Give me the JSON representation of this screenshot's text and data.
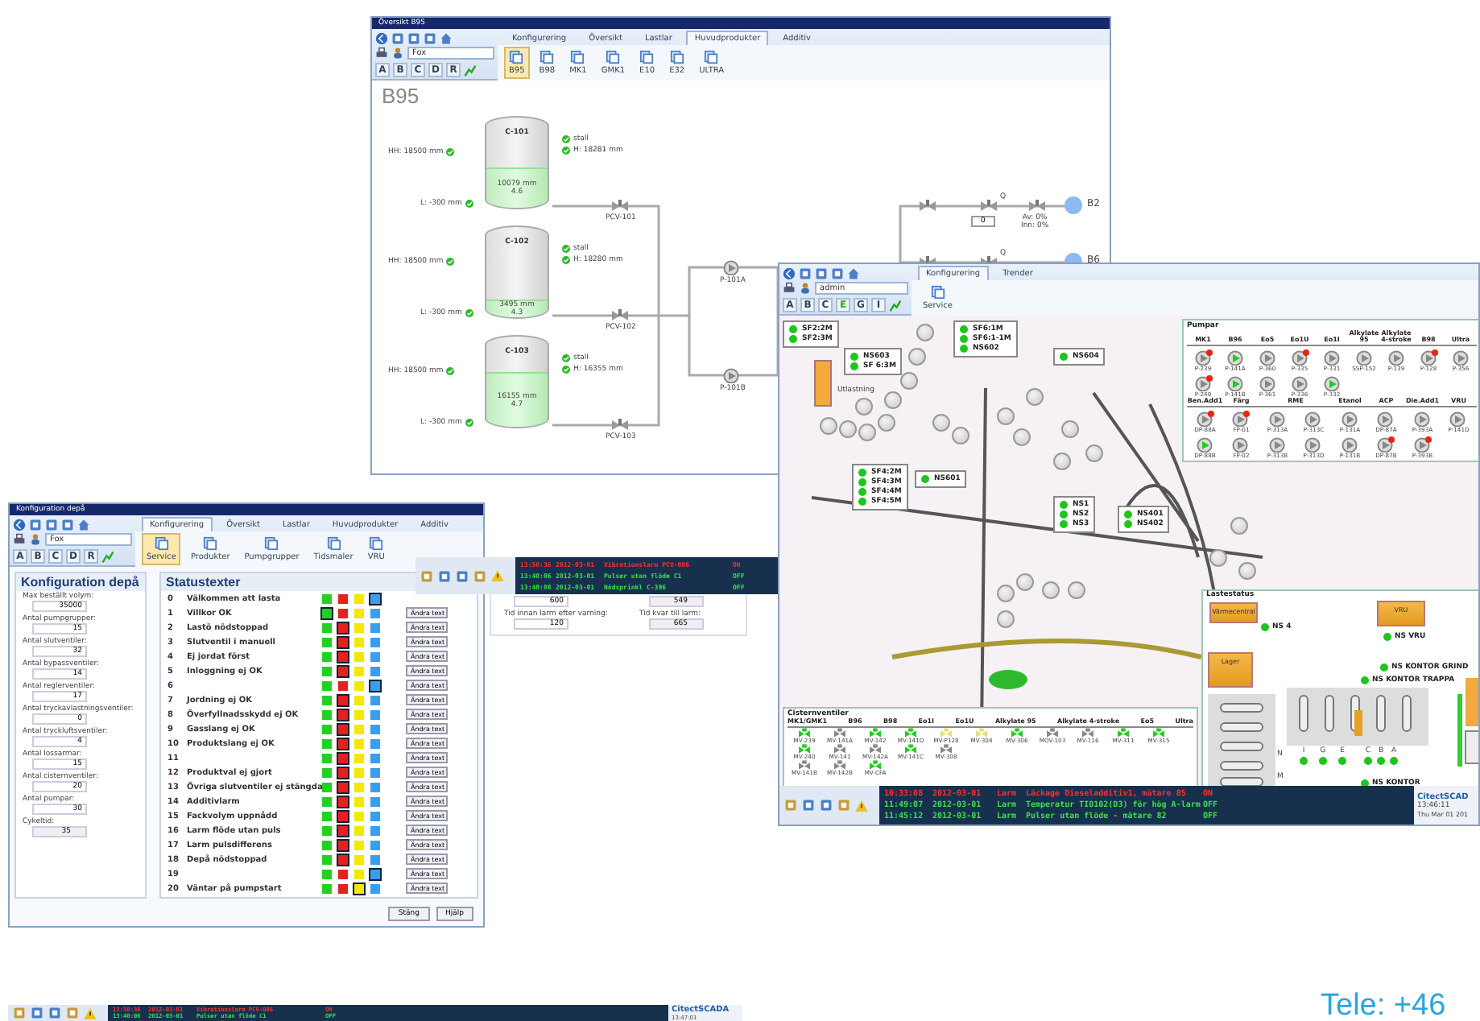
{
  "tank_window": {
    "title": "Översikt B95",
    "tabs": [
      {
        "label": "Konfigurering",
        "selected": false
      },
      {
        "label": "Översikt",
        "selected": false
      },
      {
        "label": "Lastlar",
        "selected": false
      },
      {
        "label": "Huvudprodukter",
        "selected": true
      },
      {
        "label": "Additiv",
        "selected": false
      }
    ],
    "field": "Fox",
    "letters": [
      {
        "label": "A",
        "selected": false
      },
      {
        "label": "B",
        "selected": false
      },
      {
        "label": "C",
        "selected": false
      },
      {
        "label": "D",
        "selected": false
      },
      {
        "label": "R",
        "selected": false
      }
    ],
    "buttons": [
      {
        "label": "B95",
        "selected": true
      },
      {
        "label": "B98",
        "selected": false
      },
      {
        "label": "MK1",
        "selected": false
      },
      {
        "label": "GMK1",
        "selected": false
      },
      {
        "label": "E10",
        "selected": false
      },
      {
        "label": "E32",
        "selected": false
      },
      {
        "label": "ULTRA",
        "selected": false
      }
    ],
    "heading": "B95",
    "tanks": [
      {
        "name": "C-101",
        "high_limit": "HH: 18500 mm",
        "low_limit": "L: -300 mm",
        "level": 0.45,
        "reading": "10079 mm",
        "temperature": "4.6",
        "status": "stall",
        "height": "H: 18281 mm",
        "valve": "PCV-101"
      },
      {
        "name": "C-102",
        "high_limit": "HH: 18500 mm",
        "low_limit": "L: -300 mm",
        "level": 0.2,
        "reading": "3495 mm",
        "temperature": "4.3",
        "status": "stall",
        "height": "H: 18280 mm",
        "valve": "PCV-102"
      },
      {
        "name": "C-103",
        "high_limit": "HH: 18500 mm",
        "low_limit": "L: -300 mm",
        "level": 0.6,
        "reading": "16155 mm",
        "temperature": "4.7",
        "status": "stall",
        "height": "H: 16355 mm",
        "valve": "PCV-103"
      }
    ],
    "pumps": [
      {
        "name": "P-101A"
      },
      {
        "name": "P-101B"
      }
    ],
    "outlets": [
      {
        "name": "B2",
        "meter": "Q",
        "flow": "0",
        "shares": [
          "Av: 0%",
          "Inn: 0%"
        ]
      },
      {
        "name": "B6",
        "meter": "Q"
      }
    ]
  },
  "config_window": {
    "title": "Konfiguration depå",
    "tabs": [
      {
        "label": "Konfigurering",
        "selected": true
      },
      {
        "label": "Översikt",
        "selected": false
      },
      {
        "label": "Lastlar",
        "selected": false
      },
      {
        "label": "Huvudprodukter",
        "selected": false
      },
      {
        "label": "Additiv",
        "selected": false
      }
    ],
    "field": "Fox",
    "letters": [
      {
        "label": "A",
        "selected": false
      },
      {
        "label": "B",
        "selected": false
      },
      {
        "label": "C",
        "selected": false
      },
      {
        "label": "D",
        "selected": false
      },
      {
        "label": "R",
        "selected": false
      }
    ],
    "buttons": [
      {
        "label": "Service",
        "selected": true
      },
      {
        "label": "Produkter",
        "selected": false
      },
      {
        "label": "Pumpgrupper",
        "selected": false
      },
      {
        "label": "Tidsmaler",
        "selected": false
      },
      {
        "label": "VRU",
        "selected": false
      }
    ],
    "settings": {
      "title": "Konfiguration depå",
      "fields": [
        {
          "label": "Max beställt volym:",
          "value": "35000",
          "readonly": false
        },
        {
          "label": "Antal pumpgrupper:",
          "value": "15",
          "readonly": false
        },
        {
          "label": "Antal slutventiler:",
          "value": "32",
          "readonly": false
        },
        {
          "label": "Antal bypassventiler:",
          "value": "14",
          "readonly": false
        },
        {
          "label": "Antal reglerventiler:",
          "value": "17",
          "readonly": false
        },
        {
          "label": "Antal tryckavlastningsventiler:",
          "value": "0",
          "readonly": false
        },
        {
          "label": "Antal tryckluftsventiler:",
          "value": "4",
          "readonly": false
        },
        {
          "label": "Antal lossarmar:",
          "value": "15",
          "readonly": false
        },
        {
          "label": "Antal cisternventiler:",
          "value": "20",
          "readonly": false
        },
        {
          "label": "Antal pumpar:",
          "value": "30",
          "readonly": false
        },
        {
          "label": "Cykeltid:",
          "value": "35",
          "readonly": true
        }
      ]
    },
    "status_texts": {
      "title": "Statustexter",
      "rows": [
        {
          "number": "0",
          "text": "Välkommen att lasta",
          "swatches": [
            {
              "color": "#22d022",
              "selected": false
            },
            {
              "color": "#e52020",
              "selected": false
            },
            {
              "color": "#f4e800",
              "selected": false
            },
            {
              "color": "#3a9ef0",
              "selected": true
            }
          ]
        },
        {
          "number": "1",
          "text": "Villkor OK",
          "button": "Ändra text",
          "swatches": [
            {
              "color": "#22d022",
              "selected": true
            },
            {
              "color": "#e52020",
              "selected": false
            },
            {
              "color": "#f4e800",
              "selected": false
            },
            {
              "color": "#3a9ef0",
              "selected": false
            }
          ]
        },
        {
          "number": "2",
          "text": "Lastö nödstoppad",
          "button": "Ändra text",
          "swatches": [
            {
              "color": "#22d022",
              "selected": false
            },
            {
              "color": "#e52020",
              "selected": true
            },
            {
              "color": "#f4e800",
              "selected": false
            },
            {
              "color": "#3a9ef0",
              "selected": false
            }
          ]
        },
        {
          "number": "3",
          "text": "Slutventil i manuell",
          "button": "Ändra text",
          "swatches": [
            {
              "color": "#22d022",
              "selected": false
            },
            {
              "color": "#e52020",
              "selected": true
            },
            {
              "color": "#f4e800",
              "selected": false
            },
            {
              "color": "#3a9ef0",
              "selected": false
            }
          ]
        },
        {
          "number": "4",
          "text": "Ej jordat först",
          "button": "Ändra text",
          "swatches": [
            {
              "color": "#22d022",
              "selected": false
            },
            {
              "color": "#e52020",
              "selected": true
            },
            {
              "color": "#f4e800",
              "selected": false
            },
            {
              "color": "#3a9ef0",
              "selected": false
            }
          ]
        },
        {
          "number": "5",
          "text": "Inloggning ej OK",
          "button": "Ändra text",
          "swatches": [
            {
              "color": "#22d022",
              "selected": false
            },
            {
              "color": "#e52020",
              "selected": true
            },
            {
              "color": "#f4e800",
              "selected": false
            },
            {
              "color": "#3a9ef0",
              "selected": false
            }
          ]
        },
        {
          "number": "6",
          "button": "Ändra text",
          "swatches": [
            {
              "color": "#22d022",
              "selected": false
            },
            {
              "color": "#e52020",
              "selected": false
            },
            {
              "color": "#f4e800",
              "selected": false
            },
            {
              "color": "#3a9ef0",
              "selected": true
            }
          ]
        },
        {
          "number": "7",
          "text": "Jordning ej OK",
          "button": "Ändra text",
          "swatches": [
            {
              "color": "#22d022",
              "selected": false
            },
            {
              "color": "#e52020",
              "selected": true
            },
            {
              "color": "#f4e800",
              "selected": false
            },
            {
              "color": "#3a9ef0",
              "selected": false
            }
          ]
        },
        {
          "number": "8",
          "text": "Överfyllnadsskydd ej OK",
          "button": "Ändra text",
          "swatches": [
            {
              "color": "#22d022",
              "selected": false
            },
            {
              "color": "#e52020",
              "selected": true
            },
            {
              "color": "#f4e800",
              "selected": false
            },
            {
              "color": "#3a9ef0",
              "selected": false
            }
          ]
        },
        {
          "number": "9",
          "text": "Gasslang ej OK",
          "button": "Ändra text",
          "swatches": [
            {
              "color": "#22d022",
              "selected": false
            },
            {
              "color": "#e52020",
              "selected": true
            },
            {
              "color": "#f4e800",
              "selected": false
            },
            {
              "color": "#3a9ef0",
              "selected": false
            }
          ]
        },
        {
          "number": "10",
          "text": "Produktslang ej OK",
          "button": "Ändra text",
          "swatches": [
            {
              "color": "#22d022",
              "selected": false
            },
            {
              "color": "#e52020",
              "selected": true
            },
            {
              "color": "#f4e800",
              "selected": false
            },
            {
              "color": "#3a9ef0",
              "selected": false
            }
          ]
        },
        {
          "number": "11",
          "button": "Ändra text",
          "swatches": [
            {
              "color": "#22d022",
              "selected": false
            },
            {
              "color": "#e52020",
              "selected": true
            },
            {
              "color": "#f4e800",
              "selected": false
            },
            {
              "color": "#3a9ef0",
              "selected": false
            }
          ]
        },
        {
          "number": "12",
          "text": "Produktval ej gjort",
          "button": "Ändra text",
          "swatches": [
            {
              "color": "#22d022",
              "selected": false
            },
            {
              "color": "#e52020",
              "selected": true
            },
            {
              "color": "#f4e800",
              "selected": false
            },
            {
              "color": "#3a9ef0",
              "selected": false
            }
          ]
        },
        {
          "number": "13",
          "text": "Övriga slutventiler ej stängda",
          "button": "Ändra text",
          "swatches": [
            {
              "color": "#22d022",
              "selected": false
            },
            {
              "color": "#e52020",
              "selected": true
            },
            {
              "color": "#f4e800",
              "selected": false
            },
            {
              "color": "#3a9ef0",
              "selected": false
            }
          ]
        },
        {
          "number": "14",
          "text": "Additivlarm",
          "button": "Ändra text",
          "swatches": [
            {
              "color": "#22d022",
              "selected": false
            },
            {
              "color": "#e52020",
              "selected": true
            },
            {
              "color": "#f4e800",
              "selected": false
            },
            {
              "color": "#3a9ef0",
              "selected": false
            }
          ]
        },
        {
          "number": "15",
          "text": "Fackvolym uppnådd",
          "button": "Ändra text",
          "swatches": [
            {
              "color": "#22d022",
              "selected": false
            },
            {
              "color": "#e52020",
              "selected": true
            },
            {
              "color": "#f4e800",
              "selected": false
            },
            {
              "color": "#3a9ef0",
              "selected": false
            }
          ]
        },
        {
          "number": "16",
          "text": "Larm flöde utan puls",
          "button": "Ändra text",
          "swatches": [
            {
              "color": "#22d022",
              "selected": false
            },
            {
              "color": "#e52020",
              "selected": true
            },
            {
              "color": "#f4e800",
              "selected": false
            },
            {
              "color": "#3a9ef0",
              "selected": false
            }
          ]
        },
        {
          "number": "17",
          "text": "Larm pulsdifferens",
          "button": "Ändra text",
          "swatches": [
            {
              "color": "#22d022",
              "selected": false
            },
            {
              "color": "#e52020",
              "selected": true
            },
            {
              "color": "#f4e800",
              "selected": false
            },
            {
              "color": "#3a9ef0",
              "selected": false
            }
          ]
        },
        {
          "number": "18",
          "text": "Depå nödstoppad",
          "button": "Ändra text",
          "swatches": [
            {
              "color": "#22d022",
              "selected": false
            },
            {
              "color": "#e52020",
              "selected": true
            },
            {
              "color": "#f4e800",
              "selected": false
            },
            {
              "color": "#3a9ef0",
              "selected": false
            }
          ]
        },
        {
          "number": "19",
          "button": "Ändra text",
          "swatches": [
            {
              "color": "#22d022",
              "selected": false
            },
            {
              "color": "#e52020",
              "selected": false
            },
            {
              "color": "#f4e800",
              "selected": false
            },
            {
              "color": "#3a9ef0",
              "selected": true
            }
          ]
        },
        {
          "number": "20",
          "text": "Väntar på pumpstart",
          "button": "Ändra text",
          "swatches": [
            {
              "color": "#22d022",
              "selected": false
            },
            {
              "color": "#e52020",
              "selected": false
            },
            {
              "color": "#f4e800",
              "selected": true
            },
            {
              "color": "#3a9ef0",
              "selected": false
            }
          ]
        }
      ]
    },
    "footer_buttons": [
      "Stäng",
      "Hjälp"
    ]
  },
  "alarm_popup": {
    "alarms": [
      {
        "time": "13:50:36",
        "date": "2012-03-01",
        "message": "Vibrationslarm PCV-086",
        "state": "ON",
        "active": true
      },
      {
        "time": "13:40:06",
        "date": "2012-03-01",
        "message": "Pulser utan flöde C1",
        "state": "OFF",
        "active": false
      },
      {
        "time": "13:40:08",
        "date": "2012-03-01",
        "message": "Nödsprinkl C-396",
        "state": "OFF",
        "active": false
      }
    ],
    "fields": [
      {
        "value": "600",
        "readonly": false
      },
      {
        "value": "549",
        "readonly": true
      },
      {
        "label": "Tid innan larm efter varning:",
        "value": "120",
        "readonly": false
      },
      {
        "label": "Tid kvar till larm:",
        "value": "665",
        "readonly": true
      }
    ]
  },
  "map_window": {
    "tabs": [
      {
        "label": "Konfigurering",
        "selected": true
      },
      {
        "label": "Trender",
        "selected": false
      }
    ],
    "field": "admin",
    "letters": [
      {
        "label": "A",
        "selected": false
      },
      {
        "label": "B",
        "selected": false
      },
      {
        "label": "C",
        "selected": false
      },
      {
        "label": "E",
        "selected": true
      },
      {
        "label": "G",
        "selected": false
      },
      {
        "label": "I",
        "selected": false
      }
    ],
    "buttons": [
      {
        "label": "Service",
        "selected": false
      }
    ],
    "node_groups": [
      {
        "signals": [
          {
            "name": "SF2:2M",
            "on": true
          },
          {
            "name": "SF2:3M",
            "on": true
          }
        ]
      },
      {
        "signals": [
          {
            "name": "NS603",
            "on": true
          },
          {
            "name": "SF 6:3M",
            "on": true
          }
        ]
      },
      {
        "signals": [
          {
            "name": "SF6:1M",
            "on": true
          },
          {
            "name": "SF6:1-1M",
            "on": true
          },
          {
            "name": "NS602",
            "on": true
          }
        ]
      },
      {
        "signals": [
          {
            "name": "NS604",
            "on": true
          }
        ]
      },
      {
        "signals": [
          {
            "name": "SF4:2M",
            "on": true
          },
          {
            "name": "SF4:3M",
            "on": true
          },
          {
            "name": "SF4:4M",
            "on": true
          },
          {
            "name": "SF4:5M",
            "on": true
          }
        ]
      },
      {
        "signals": [
          {
            "name": "NS601",
            "on": true
          }
        ]
      },
      {
        "signals": [
          {
            "name": "NS1",
            "on": true
          },
          {
            "name": "NS2",
            "on": true
          },
          {
            "name": "NS3",
            "on": true
          }
        ]
      },
      {
        "signals": [
          {
            "name": "NS401",
            "on": true
          },
          {
            "name": "NS402",
            "on": true
          }
        ]
      }
    ],
    "area_label": "Utlastning",
    "pump_panel": {
      "title": "Pumpar",
      "sections": [
        {
          "headers": [
            {
              "label": "MK1"
            },
            {
              "label": "B96"
            },
            {
              "label": "Eo5"
            },
            {
              "label": "Eo1U"
            },
            {
              "label": "Eo1I"
            },
            {
              "label": "Alkylate 95"
            },
            {
              "label": "Alkylate 4-stroke"
            },
            {
              "label": "B98"
            },
            {
              "label": "Ultra"
            }
          ],
          "rows": [
            [
              {
                "name": "P-239",
                "running": false,
                "alarm": true
              },
              {
                "name": "P-141A",
                "running": true,
                "alarm": false
              },
              {
                "name": "P-360",
                "running": false,
                "alarm": false
              },
              {
                "name": "P-335",
                "running": false,
                "alarm": true
              },
              {
                "name": "P-331",
                "running": false,
                "alarm": false
              },
              {
                "name": "SSP-152",
                "running": false,
                "alarm": false
              },
              {
                "name": "P-139",
                "running": false,
                "alarm": false
              },
              {
                "name": "P-128",
                "running": false,
                "alarm": true
              },
              {
                "name": "P-356",
                "running": false,
                "alarm": false
              }
            ],
            [
              {
                "name": "P-240",
                "running": false,
                "alarm": true
              },
              {
                "name": "P-141B",
                "running": true,
                "alarm": false
              },
              {
                "name": "P-361",
                "running": false,
                "alarm": false
              },
              {
                "name": "P-336",
                "running": false,
                "alarm": false
              },
              {
                "name": "P-332",
                "running": true,
                "alarm": false
              }
            ]
          ]
        },
        {
          "headers": [
            {
              "label": "Ben.Add1"
            },
            {
              "label": "Färg"
            },
            {
              "label": "RME",
              "wide": true
            },
            {
              "label": "Etanol"
            },
            {
              "label": "ACP"
            },
            {
              "label": "Die.Add1"
            },
            {
              "label": "VRU"
            }
          ],
          "rows": [
            [
              {
                "name": "DP-88A",
                "running": false,
                "alarm": true
              },
              {
                "name": "FP-01",
                "running": false,
                "alarm": true
              },
              {
                "name": "P-313A",
                "running": false,
                "alarm": false
              },
              {
                "name": "P-313C",
                "running": false,
                "alarm": false
              },
              {
                "name": "P-131A",
                "running": false,
                "alarm": false
              },
              {
                "name": "DP-87A",
                "running": false,
                "alarm": false
              },
              {
                "name": "P-393A",
                "running": false,
                "alarm": false
              },
              {
                "name": "P-141D",
                "running": false,
                "alarm": false
              }
            ],
            [
              {
                "name": "DP-88B",
                "running": true,
                "alarm": false
              },
              {
                "name": "FP-02",
                "running": false,
                "alarm": false
              },
              {
                "name": "P-313B",
                "running": false,
                "alarm": false
              },
              {
                "name": "P-313D",
                "running": false,
                "alarm": false
              },
              {
                "name": "P-131B",
                "running": false,
                "alarm": false
              },
              {
                "name": "DP-87B",
                "running": false,
                "alarm": true
              },
              {
                "name": "P-393B",
                "running": false,
                "alarm": true
              }
            ]
          ]
        }
      ]
    },
    "valve_panel": {
      "title": "Cisternventiler",
      "headers": [
        "MK1/GMK1",
        "B96",
        "B98",
        "Eo1I",
        "Eo1U",
        "Alkylate 95",
        "Alkylate 4-stroke",
        "Eo5",
        "Ultra"
      ],
      "rows": [
        [
          {
            "name": "MV-239",
            "color": "#22cc22"
          },
          {
            "name": "MV-141A",
            "color": "#888888"
          },
          {
            "name": "MV-142",
            "color": "#22cc22"
          },
          {
            "name": "MV-141D",
            "color": "#22cc22"
          },
          {
            "name": "MV-P128",
            "color": "#e8e070"
          },
          {
            "name": "MV-304",
            "color": "#e8e070"
          },
          {
            "name": "MV-306",
            "color": "#22cc22"
          },
          {
            "name": "MOV-103",
            "color": "#888888"
          },
          {
            "name": "MV-116",
            "color": "#888888"
          },
          {
            "name": "MV-311",
            "color": "#22cc22"
          },
          {
            "name": "MV-315",
            "color": "#22cc22"
          }
        ],
        [
          {
            "name": "MV-240",
            "color": "#22cc22"
          },
          {
            "name": "MV-141",
            "color": "#888888"
          },
          {
            "name": "MV-142A",
            "color": "#888888"
          },
          {
            "name": "MV-141C",
            "color": "#22cc22"
          },
          {
            "name": "MV-308",
            "color": "#888888"
          }
        ],
        [
          {
            "name": "MV-141B",
            "color": "#888888"
          },
          {
            "name": "MV-142B",
            "color": "#888888"
          },
          {
            "name": "MV-CFA",
            "color": "#22cc22"
          }
        ]
      ]
    },
    "loading_status": {
      "title": "Lastestatus",
      "buildings": [
        "Värmecentral",
        "Lager",
        "VRU"
      ],
      "signals": [
        {
          "name": "NS 4",
          "on": true
        },
        {
          "name": "NS VRU",
          "on": true
        },
        {
          "name": "NS KONTOR GRIND",
          "on": true
        },
        {
          "name": "NS KONTOR TRAPPA",
          "on": true
        },
        {
          "name": "NS KONTOR",
          "on": true
        }
      ],
      "bays": [
        {
          "name": "I",
          "on": true
        },
        {
          "name": "G",
          "on": true
        },
        {
          "name": "E",
          "on": true
        },
        {
          "name": "C",
          "on": true
        },
        {
          "name": "B",
          "on": true
        },
        {
          "name": "A",
          "on": true
        }
      ],
      "rows": [
        "N",
        "M"
      ]
    },
    "alarms": [
      {
        "time": "10:33:08",
        "date": "2012-03-01",
        "type": "Larm",
        "message": "Läckage Dieseladditiv1, mätare 85",
        "state": "ON",
        "active": true
      },
      {
        "time": "11:49:07",
        "date": "2012-03-01",
        "type": "Larm",
        "message": "Temperatur TI0102(D3) för hög A-larm",
        "state": "OFF",
        "active": false
      },
      {
        "time": "11:45:12",
        "date": "2012-03-01",
        "type": "Larm",
        "message": "Pulser utan flöde - mätare 82",
        "state": "OFF",
        "active": false
      }
    ],
    "brand": "CitectSCAD",
    "time": "13:46:11",
    "date": "Thu Mar 01 201"
  },
  "footer": {
    "alarms": [
      {
        "time": "13:50:36",
        "date": "2012-03-01",
        "message": "Vibrationslarm PCV-086",
        "state": "ON",
        "active": true
      },
      {
        "time": "13:40:06",
        "date": "2012-03-01",
        "message": "Pulser utan flöde C1",
        "state": "OFF",
        "active": false
      }
    ],
    "brand": "CitectSCADA",
    "time": "13:47:01",
    "phone": "Tele: +46"
  }
}
